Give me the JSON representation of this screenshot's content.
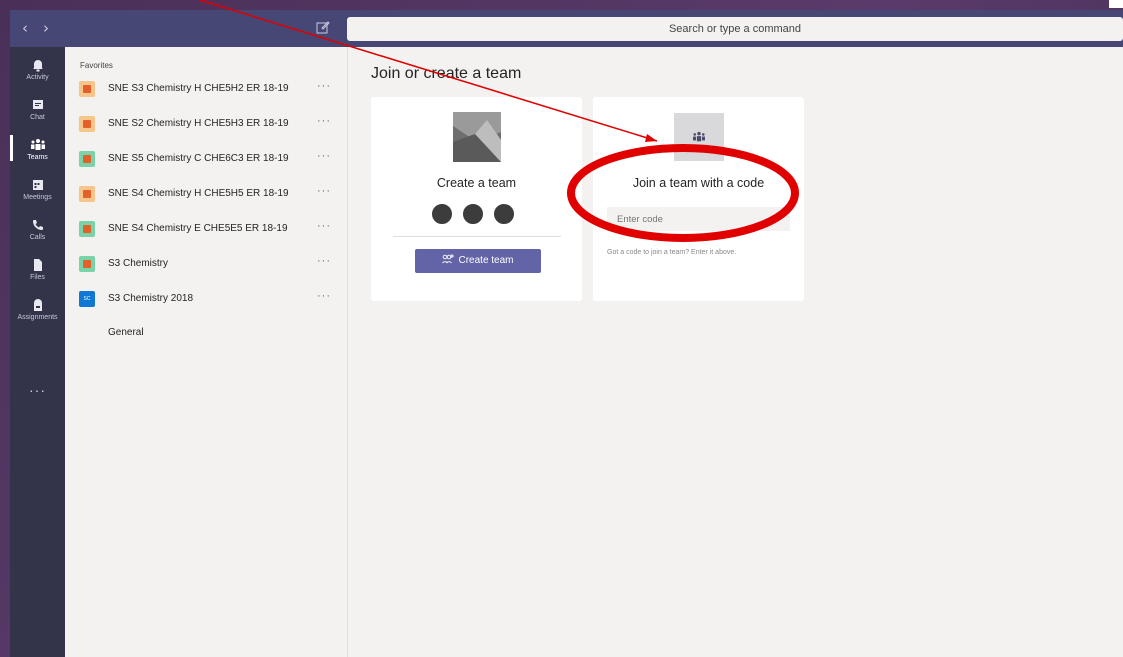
{
  "titlebar": {
    "back_glyph": "‹",
    "forward_glyph": "›",
    "search_placeholder": "Search or type a command"
  },
  "rail": {
    "items": [
      {
        "label": "Activity",
        "icon": "bell-icon"
      },
      {
        "label": "Chat",
        "icon": "chat-icon"
      },
      {
        "label": "Teams",
        "icon": "teams-icon"
      },
      {
        "label": "Meetings",
        "icon": "calendar-icon"
      },
      {
        "label": "Calls",
        "icon": "phone-icon"
      },
      {
        "label": "Files",
        "icon": "file-icon"
      },
      {
        "label": "Assignments",
        "icon": "backpack-icon"
      }
    ],
    "more": "···"
  },
  "teamlist": {
    "favorites_label": "Favorites",
    "teams": [
      {
        "name": "SNE S3 Chemistry H CHE5H2 ER 18-19",
        "color": "orange",
        "more": "···"
      },
      {
        "name": "SNE S2 Chemistry H CHE5H3 ER 18-19",
        "color": "orange",
        "more": "···"
      },
      {
        "name": "SNE S5 Chemistry C CHE6C3 ER 18-19",
        "color": "green",
        "more": "···"
      },
      {
        "name": "SNE S4 Chemistry H CHE5H5 ER 18-19",
        "color": "orange",
        "more": "···"
      },
      {
        "name": "SNE S4 Chemistry E CHE5E5 ER 18-19",
        "color": "green",
        "more": "···"
      },
      {
        "name": "S3 Chemistry",
        "color": "green",
        "more": "···"
      },
      {
        "name": "S3 Chemistry 2018",
        "color": "blue",
        "initials": "SC",
        "more": "···"
      }
    ],
    "channel": "General"
  },
  "main": {
    "title": "Join or create a team",
    "create_card": {
      "title": "Create a team",
      "button_label": "Create team"
    },
    "join_card": {
      "title": "Join a team with a code",
      "input_placeholder": "Enter code",
      "help_text": "Got a code to join a team? Enter it above."
    }
  },
  "colors": {
    "accent": "#6264a7",
    "titlebar": "#464775",
    "rail": "#33344a",
    "annotation": "#e00000"
  }
}
